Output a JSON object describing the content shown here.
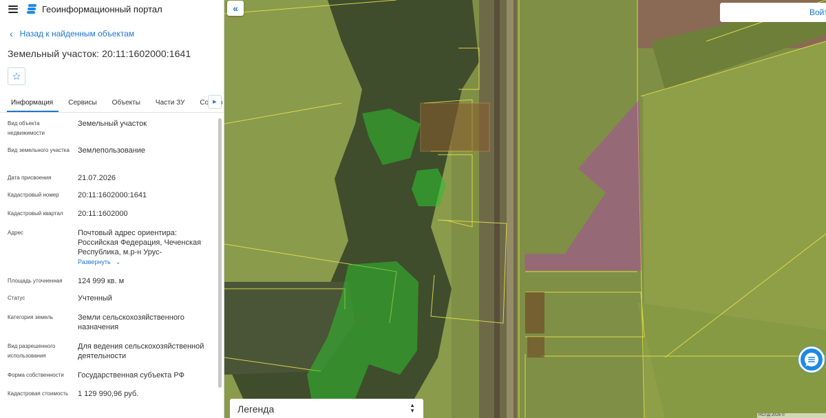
{
  "app": {
    "title": "Геоинформационный портал"
  },
  "nav": {
    "back_label": "Назад к найденным объектам"
  },
  "object": {
    "title": "Земельный участок: 20:11:1602000:1641"
  },
  "tabs": [
    {
      "label": "Информация",
      "active": true
    },
    {
      "label": "Сервисы"
    },
    {
      "label": "Объекты"
    },
    {
      "label": "Части ЗУ"
    },
    {
      "label": "Состав"
    }
  ],
  "properties": [
    {
      "label": "Вид объекта недвижимости",
      "value": "Земельный участок"
    },
    {
      "label": "Вид земельного участка",
      "value": "Землепользование"
    },
    {
      "label": "Дата присвоения",
      "value": "21.07.2026"
    },
    {
      "label": "Кадастровый номер",
      "value": "20:11:1602000:1641"
    },
    {
      "label": "Кадастровый квартал",
      "value": "20:11:1602000"
    },
    {
      "label": "Адрес",
      "value": "Почтовый адрес ориентира: Российская Федерация, Чеченская Республика, м.р-н Урус-",
      "link": "Развернуть"
    },
    {
      "label": "Площадь уточненная",
      "value": "124 999 кв. м"
    },
    {
      "label": "Статус",
      "value": "Учтенный"
    },
    {
      "label": "Категория земель",
      "value": "Земли сельскохозяйственного назначения"
    },
    {
      "label": "Вид разрешенного использования",
      "value": "Для ведения сельскохозяйственной деятельности"
    },
    {
      "label": "Форма собственности",
      "value": "Государственная субъекта РФ"
    },
    {
      "label": "Кадастровая стоимость",
      "value": "1 129 990,96 руб."
    }
  ],
  "map": {
    "login_label": "Войти",
    "legend_label": "Легенда",
    "attribution": "НСПД 2026 ©"
  },
  "icons": {
    "menu": "menu-icon",
    "logo": "layers-logo-icon",
    "back": "chevron-left-icon",
    "favorite": "star-icon",
    "tabs_next": "caret-right-icon",
    "collapse": "double-chevron-left-icon",
    "chat": "chat-bubble-icon",
    "legend_toggle": "up-down-arrows-icon",
    "expand": "chevron-down-icon"
  },
  "colors": {
    "accent": "#1976d2",
    "selected_parcel": "#c026d3",
    "parcel_outline": "#e8e04a",
    "forest_zone": "#2fbf2f"
  }
}
